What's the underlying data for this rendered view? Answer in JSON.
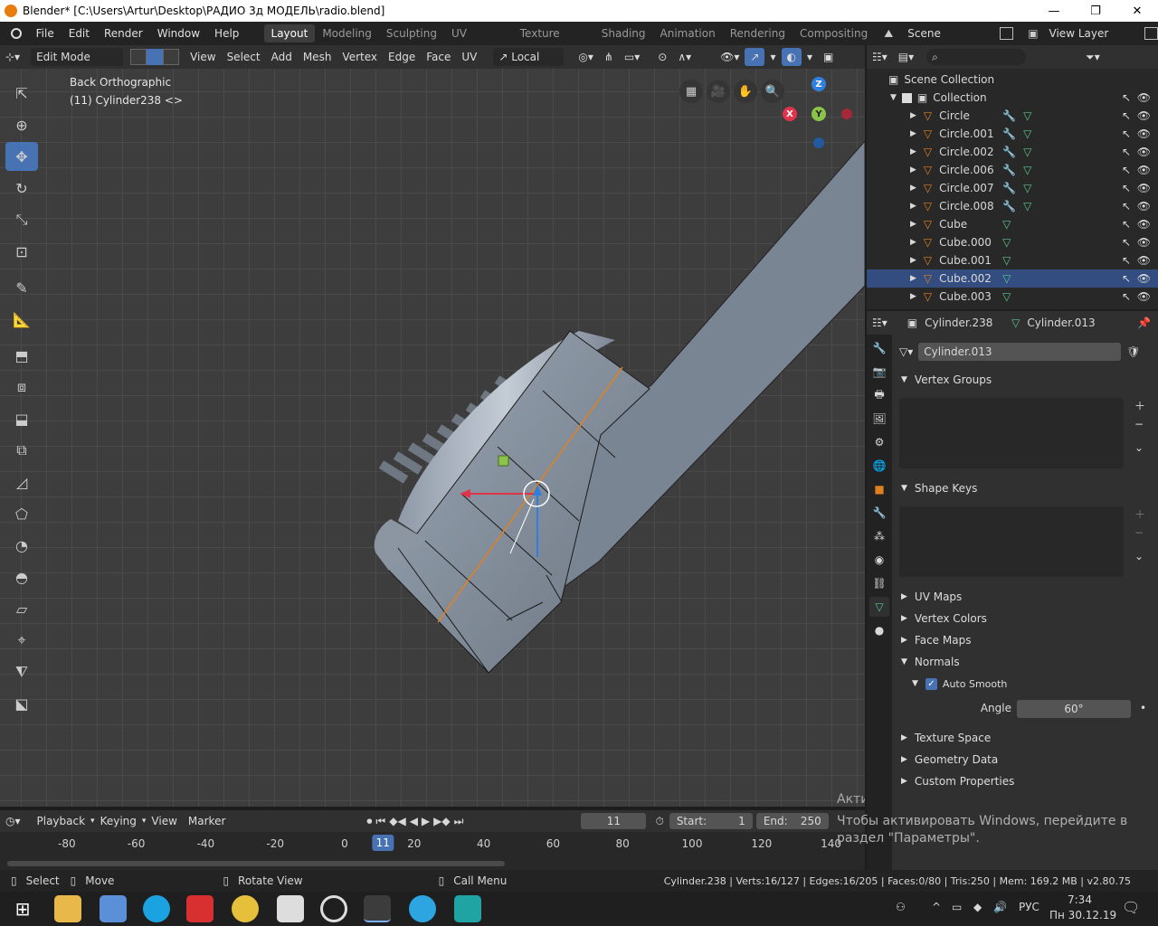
{
  "window": {
    "title": "Blender* [C:\\Users\\Artur\\Desktop\\РАДИО 3д МОДЕЛЬ\\radio.blend]",
    "minimize": "—",
    "maximize": "❐",
    "close": "✕"
  },
  "menu": [
    "File",
    "Edit",
    "Render",
    "Window",
    "Help"
  ],
  "workspaces": [
    "Layout",
    "Modeling",
    "Sculpting",
    "UV Editing",
    "Texture Paint",
    "Shading",
    "Animation",
    "Rendering",
    "Compositing"
  ],
  "scene": {
    "label": "Scene",
    "view_layer": "View Layer"
  },
  "viewport_header": {
    "mode": "Edit Mode",
    "menus": [
      "View",
      "Select",
      "Add",
      "Mesh",
      "Vertex",
      "Edge",
      "Face",
      "UV"
    ],
    "orientation": "Local"
  },
  "viewport": {
    "view_name": "Back Orthographic",
    "object_info": "(11) Cylinder238 <>"
  },
  "gizmo": {
    "x": "X",
    "y": "Y",
    "z": "Z"
  },
  "outliner": {
    "scene_collection": "Scene Collection",
    "collection": "Collection",
    "items": [
      {
        "name": "Circle",
        "mod": true,
        "selected": false
      },
      {
        "name": "Circle.001",
        "mod": true,
        "selected": false
      },
      {
        "name": "Circle.002",
        "mod": true,
        "selected": false
      },
      {
        "name": "Circle.006",
        "mod": true,
        "selected": false
      },
      {
        "name": "Circle.007",
        "mod": true,
        "selected": false
      },
      {
        "name": "Circle.008",
        "mod": true,
        "selected": false
      },
      {
        "name": "Cube",
        "mod": false,
        "selected": false
      },
      {
        "name": "Cube.000",
        "mod": false,
        "selected": false
      },
      {
        "name": "Cube.001",
        "mod": false,
        "selected": false
      },
      {
        "name": "Cube.002",
        "mod": false,
        "selected": true
      },
      {
        "name": "Cube.003",
        "mod": false,
        "selected": false
      }
    ]
  },
  "properties": {
    "object": "Cylinder.238",
    "mesh": "Cylinder.013",
    "mesh_field": "Cylinder.013",
    "panels": {
      "vertex_groups": "Vertex Groups",
      "shape_keys": "Shape Keys",
      "uv_maps": "UV Maps",
      "vertex_colors": "Vertex Colors",
      "face_maps": "Face Maps",
      "normals": "Normals",
      "auto_smooth": "Auto Smooth",
      "angle_label": "Angle",
      "angle_value": "60°",
      "texture_space": "Texture Space",
      "geometry_data": "Geometry Data",
      "custom_properties": "Custom Properties"
    }
  },
  "timeline": {
    "menus": [
      "Playback",
      "Keying",
      "View",
      "Marker"
    ],
    "current_frame": "11",
    "start_label": "Start:",
    "start": "1",
    "end_label": "End:",
    "end": "250",
    "ruler_labels": [
      "-80",
      "-60",
      "-40",
      "-20",
      "0",
      "20",
      "40",
      "60",
      "80",
      "100",
      "120",
      "140"
    ],
    "ruler_values": [
      -80,
      -60,
      -40,
      -20,
      0,
      20,
      40,
      60,
      80,
      100,
      120,
      140
    ],
    "playhead_label": "11",
    "playhead_value": 11
  },
  "watermark": {
    "line1": "Активация Windows",
    "line2": "Чтобы активировать Windows, перейдите в",
    "line3": "раздел \"Параметры\"."
  },
  "status": {
    "select": "Select",
    "move": "Move",
    "rotate": "Rotate View",
    "call_menu": "Call Menu",
    "stats": "Cylinder.238 | Verts:16/127 | Edges:16/205 | Faces:0/80 | Tris:250 | Mem: 169.2 MB | v2.80.75"
  },
  "taskbar": {
    "lang": "РУС",
    "time": "7:34",
    "date": "Пн 30.12.19",
    "notif": "⌨"
  },
  "colors": {
    "accent": "#4772b3",
    "selected_row": "#334d80",
    "object_orange": "#e3801e",
    "mesh_green": "#5ac88c",
    "x_red": "#e0344a",
    "y_green": "#8bc34a",
    "z_blue": "#2f7fe0"
  }
}
